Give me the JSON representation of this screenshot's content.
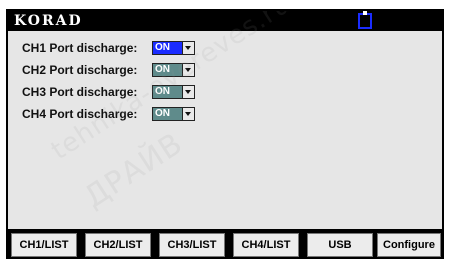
{
  "header": {
    "brand": "KORAD",
    "usb_indicator_icon": "usb-plug-icon",
    "usb_indicator_color": "#1a2cff"
  },
  "ports": [
    {
      "label": "CH1 Port discharge:",
      "value": "ON",
      "highlighted": true
    },
    {
      "label": "CH2 Port discharge:",
      "value": "ON",
      "highlighted": false
    },
    {
      "label": "CH3 Port discharge:",
      "value": "ON",
      "highlighted": false
    },
    {
      "label": "CH4 Port discharge:",
      "value": "ON",
      "highlighted": false
    }
  ],
  "menu": [
    {
      "label": "CH1/LIST"
    },
    {
      "label": "CH2/LIST"
    },
    {
      "label": "CH3/LIST"
    },
    {
      "label": "CH4/LIST"
    },
    {
      "label": "USB"
    },
    {
      "label": "Configure"
    }
  ],
  "watermark": {
    "text": "tehnika-evereves.ru",
    "text2": "ДРАЙВ"
  },
  "colors": {
    "selected_fill": "#1a2cff",
    "idle_fill": "#5f8b8b",
    "screen_bg": "#e6e6e6"
  }
}
